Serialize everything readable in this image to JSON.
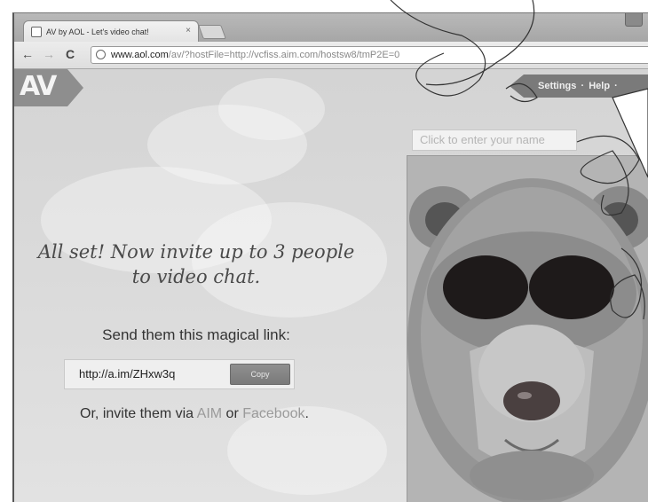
{
  "browser": {
    "tab_title": "AV by AOL - Let's video chat!",
    "tab_close": "×",
    "url_host": "www.aol.com",
    "url_path": "/av/?hostFile=http://vcfiss.aim.com/hostsw8/tmP2E=0",
    "nav_back": "←",
    "nav_forward": "→",
    "nav_reload": "C"
  },
  "app": {
    "logo_text": "AV",
    "settings_label": "Settings",
    "help_label": "Help",
    "separator": "·",
    "name_placeholder": "Click to enter your name"
  },
  "invite_panel": {
    "headline": "All set! Now invite up to 3 people to video chat.",
    "send_text": "Send them this magical link:",
    "link": "http://a.im/ZHxw3q",
    "copy_label": "Copy",
    "invite_prefix": "Or, invite them via",
    "aim_label": "AIM",
    "or_label": "or",
    "facebook_label": "Facebook",
    "period": "."
  },
  "colors": {
    "accent_gray": "#7a7a7a",
    "link_gray": "#9a9a9a"
  },
  "icons": [
    "favicon-icon",
    "new-tab-icon",
    "back-arrow-icon",
    "forward-arrow-icon",
    "reload-icon",
    "globe-icon",
    "bear-avatar"
  ]
}
